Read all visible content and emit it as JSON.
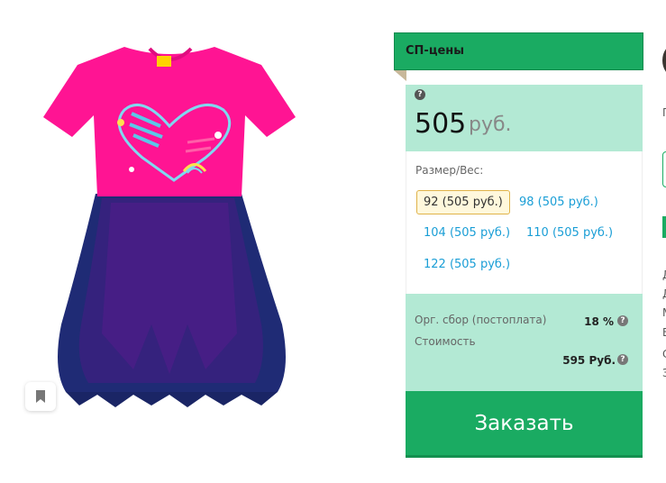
{
  "panel": {
    "header_title": "СП-цены",
    "help_symbol": "?",
    "price": "505",
    "currency": "руб.",
    "size_label": "Размер/Вес:",
    "sizes": [
      {
        "label": "92 (505 руб.)",
        "selected": true
      },
      {
        "label": "98 (505 руб.)",
        "selected": false
      },
      {
        "label": "104 (505 руб.)",
        "selected": false
      },
      {
        "label": "110 (505 руб.)",
        "selected": false
      },
      {
        "label": "122 (505 руб.)",
        "selected": false
      }
    ],
    "fee_label": "Орг. сбор (постоплата)",
    "fee_value": "18 %",
    "cost_label": "Стоимость",
    "cost_value": "595 Руб.",
    "order_button": "Заказать"
  },
  "right_column": {
    "fragments": [
      "П",
      "Д",
      "Д",
      "М",
      "В",
      "С",
      "З"
    ]
  },
  "icons": {
    "bookmark": "bookmark-icon",
    "help": "question-icon"
  },
  "colors": {
    "accent_green": "#1aab62",
    "light_green": "#b3e9d4",
    "link_blue": "#1a9ed6",
    "dress_pink": "#ff1493",
    "dress_navy": "#1c2a6e"
  }
}
